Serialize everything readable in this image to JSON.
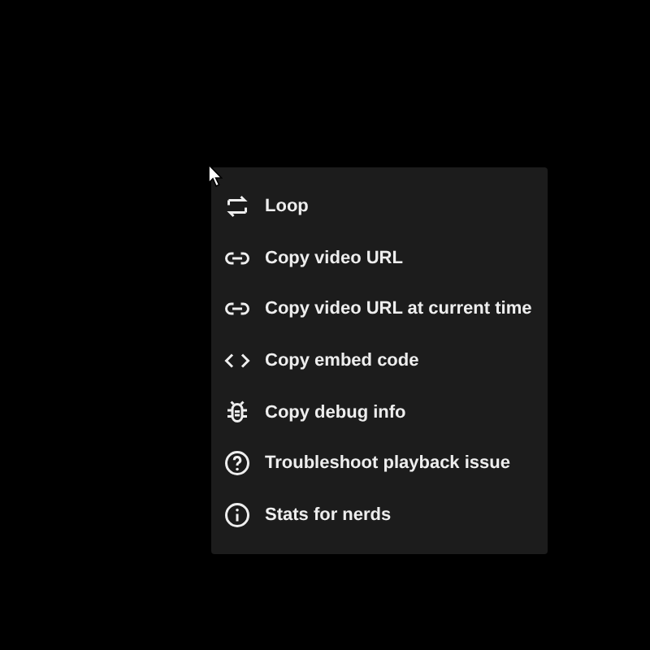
{
  "menu": {
    "items": [
      {
        "kind": "loop",
        "label": "Loop"
      },
      {
        "kind": "link",
        "label": "Copy video URL"
      },
      {
        "kind": "link",
        "label": "Copy video URL at current time"
      },
      {
        "kind": "code",
        "label": "Copy embed code"
      },
      {
        "kind": "bug",
        "label": "Copy debug info"
      },
      {
        "kind": "help",
        "label": "Troubleshoot playback issue"
      },
      {
        "kind": "info",
        "label": "Stats for nerds"
      }
    ]
  }
}
